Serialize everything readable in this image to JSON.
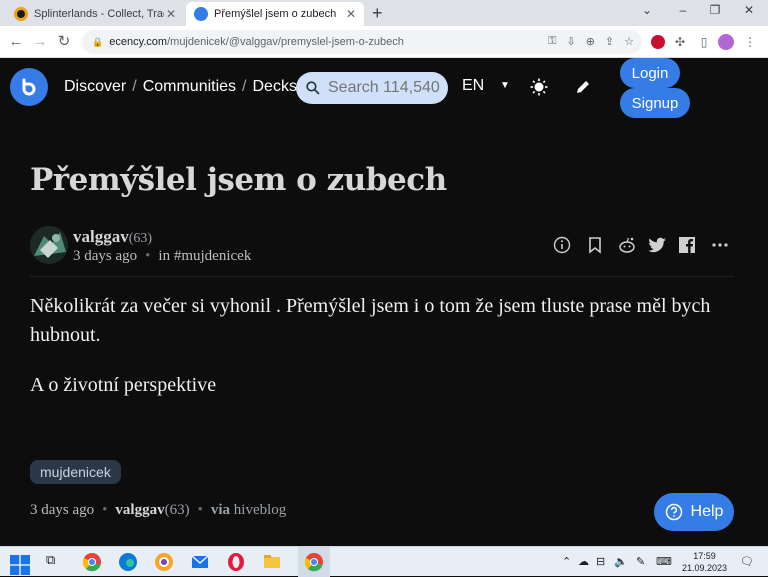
{
  "browser": {
    "tabs": [
      {
        "title": "Splinterlands - Collect, Trade, Bat",
        "active": false
      },
      {
        "title": "Přemýšlel jsem o zubech",
        "active": true
      }
    ],
    "new_tab": "+",
    "window_controls": [
      "⌄",
      "–",
      "❐",
      "✕"
    ],
    "url_host": "ecency.com",
    "url_path": "/mujdenicek/@valggav/premyslel-jsem-o-zubech"
  },
  "header": {
    "breadcrumbs": [
      "Discover",
      "Communities",
      "Decks"
    ],
    "search_placeholder": "Search 114,540",
    "language": "EN",
    "login_label": "Login",
    "signup_label": "Signup"
  },
  "post": {
    "title": "Přemýšlel jsem o zubech",
    "author": "valggav",
    "reputation": "(63)",
    "time_ago": "3 days ago",
    "community_prefix": "in",
    "community": "#mujdenicek",
    "paragraphs": [
      "Několikrát za večer si vyhonil . Přemýšlel jsem i o tom že jsem tluste prase měl bych hubnout.",
      "A o životní perspektive"
    ],
    "tag": "mujdenicek",
    "footer_time": "3 days ago",
    "footer_author": "valggav",
    "footer_reputation": "(63)",
    "via_label": "via",
    "via_app": "hiveblog"
  },
  "help_label": "Help",
  "taskbar": {
    "time": "17:59",
    "date": "21.09.2023"
  },
  "colors": {
    "accent": "#357ce6",
    "background": "#0d0d0d",
    "tag_bg": "#2c3848"
  }
}
